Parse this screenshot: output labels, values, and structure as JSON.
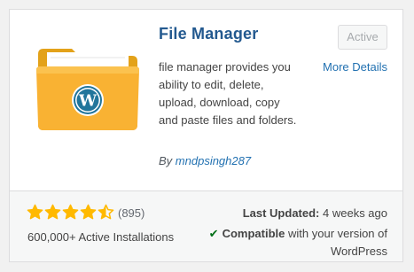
{
  "plugin": {
    "name": "File Manager",
    "status_button": "Active",
    "more_details": "More Details",
    "description": "file manager provides you ability to edit, delete, upload, download, copy and paste files and folders.",
    "author_prefix": "By",
    "author_name": "mndpsingh287",
    "icon": "folder-wordpress-icon"
  },
  "stats": {
    "rating": 4.5,
    "rating_max": 5,
    "rating_count": "(895)",
    "active_installations": "600,000+ Active Installations",
    "last_updated_label": "Last Updated:",
    "last_updated_value": "4 weeks ago",
    "compat_label": "Compatible",
    "compat_rest": "with your version of WordPress"
  },
  "colors": {
    "link": "#2271b1",
    "title": "#23598f",
    "star": "#ffb900",
    "compat_check": "#007017",
    "folder": "#f9b233"
  }
}
